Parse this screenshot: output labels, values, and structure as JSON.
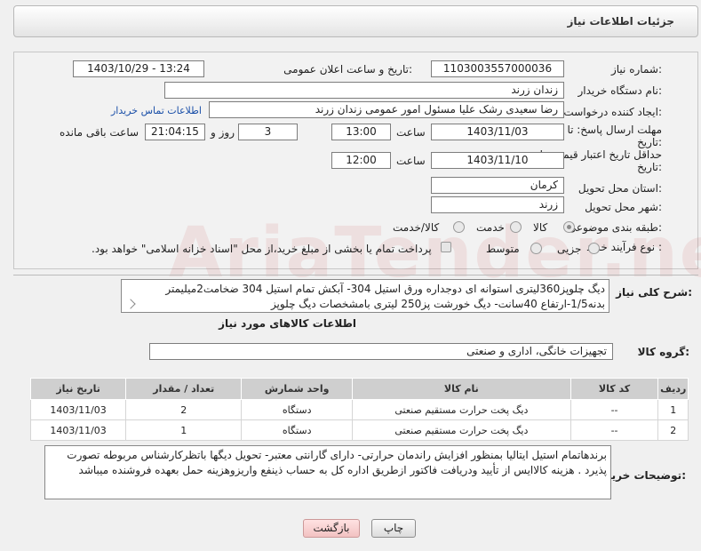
{
  "header": {
    "title": "جزئیات اطلاعات نیاز"
  },
  "form": {
    "need_number_label": "شماره نیاز:",
    "need_number": "1103003557000036",
    "announce_datetime_label": "تاریخ و ساعت اعلان عمومی:",
    "announce_datetime": "1403/10/29 - 13:24",
    "buyer_org_label": "نام دستگاه خریدار:",
    "buyer_org": "زندان زرند",
    "requester_label": "ایجاد کننده درخواست:",
    "requester": "رضا سعیدی رشک علیا مسئول امور عمومی زندان زرند",
    "contact_link": "اطلاعات تماس خریدار",
    "reply_deadline_label_1": "مهلت ارسال پاسخ: تا",
    "reply_deadline_label_2": "تاریخ:",
    "reply_date": "1403/11/03",
    "time_label": "ساعت",
    "reply_time": "13:00",
    "days_value": "3",
    "days_label": "روز و",
    "remaining_time": "21:04:15",
    "remaining_label": "ساعت باقی مانده",
    "validity_label_1": "حداقل تاریخ اعتبار قیمت: تا",
    "validity_label_2": "تاریخ:",
    "validity_date": "1403/11/10",
    "validity_time": "12:00",
    "province_label": "استان محل تحویل:",
    "province": "کرمان",
    "city_label": "شهر محل تحویل:",
    "city": "زرند",
    "category_label": "طبقه بندی موضوعی:",
    "category_options": [
      "کالا",
      "خدمت",
      "کالا/خدمت"
    ],
    "category_selected": "کالا",
    "process_label": "نوع فرآیند خرید :",
    "process_options": [
      "جزیی",
      "متوسط"
    ],
    "payment_note": "پرداخت تمام یا بخشی از مبلغ خرید،از محل \"اسناد خزانه اسلامی\" خواهد بود."
  },
  "description": {
    "label": "شرح کلی نیاز:",
    "text": "دیگ چلوپز360لیتری استوانه ای دوجداره ورق استیل 304- آبکش تمام استیل 304 ضخامت2میلیمتر بدنه1/5-ارتفاع 40سانت- دیگ خورشت پز250 لیتری بامشخصات دیگ چلوپز"
  },
  "goods": {
    "section_title": "اطلاعات کالاهای مورد نیاز",
    "group_label": "گروه کالا:",
    "group_value": "تجهیزات خانگی، اداری و صنعتی",
    "columns": [
      "ردیف",
      "کد کالا",
      "نام کالا",
      "واحد شمارش",
      "تعداد / مقدار",
      "تاریخ نیاز"
    ],
    "rows": [
      {
        "row": "1",
        "code": "--",
        "name": "دیگ پخت حرارت مستقیم صنعتی",
        "unit": "دستگاه",
        "qty": "2",
        "date": "1403/11/03"
      },
      {
        "row": "2",
        "code": "--",
        "name": "دیگ پخت حرارت مستقیم صنعتی",
        "unit": "دستگاه",
        "qty": "1",
        "date": "1403/11/03"
      }
    ]
  },
  "buyer_notes": {
    "label": "توضیحات خریدار:",
    "text": "برندهاتمام استیل ایتالیا بمنظور افزایش راندمان حرارتی- دارای گارانتی معتبر- تحویل دیگها باتظرکارشناس مربوطه تصورت پذیرد . هزینه کالاایس از تأیید ودریافت فاکتور ازطریق اداره کل به حساب ذینفع واریزوهزینه حمل بعهده فروشنده میباشد"
  },
  "buttons": {
    "print": "چاپ",
    "back": "بازگشت"
  },
  "watermark": "AriaTender.neT"
}
